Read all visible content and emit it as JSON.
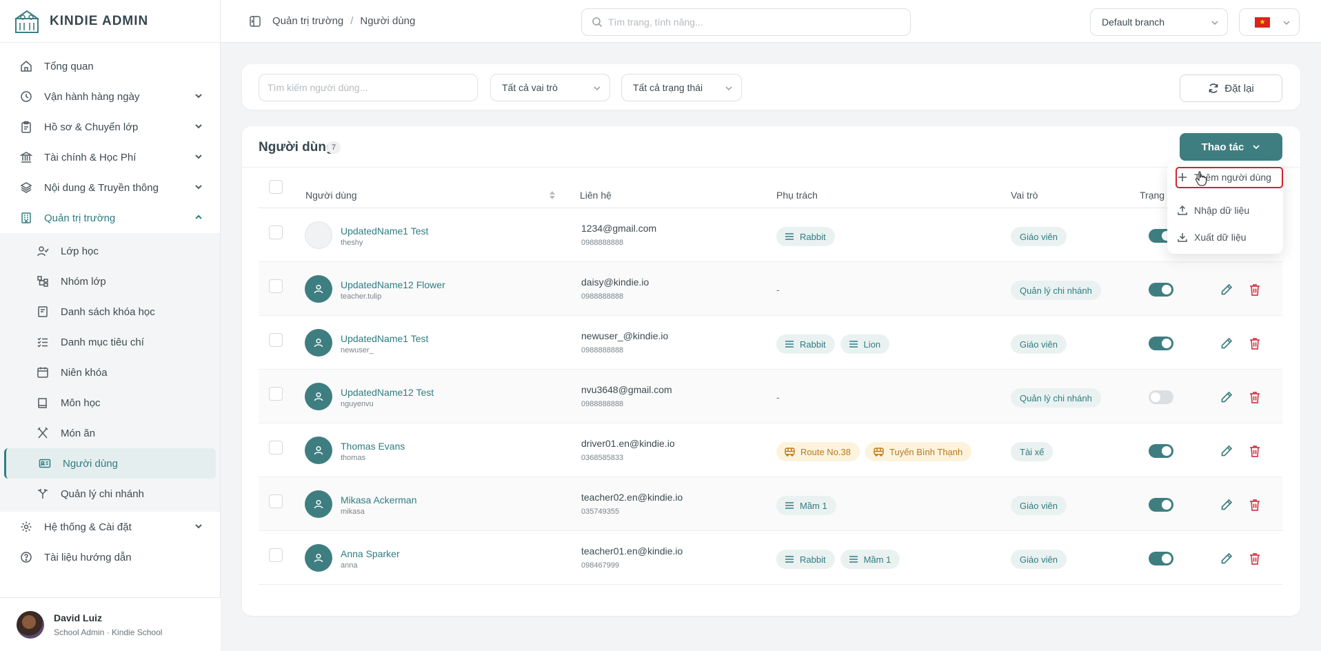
{
  "app": {
    "brand": "KINDIE ADMIN"
  },
  "sidebar": {
    "items": [
      {
        "label": "Tổng quan",
        "icon": "home-icon",
        "expandable": false
      },
      {
        "label": "Vận hành hàng ngày",
        "icon": "clock-icon",
        "expandable": true
      },
      {
        "label": "Hồ sơ & Chuyển lớp",
        "icon": "clipboard-icon",
        "expandable": true
      },
      {
        "label": "Tài chính & Học Phí",
        "icon": "bank-icon",
        "expandable": true
      },
      {
        "label": "Nội dung & Truyền thông",
        "icon": "layers-icon",
        "expandable": true
      },
      {
        "label": "Quản trị trường",
        "icon": "building-icon",
        "expandable": true,
        "open": true
      }
    ],
    "subitems": [
      {
        "label": "Lớp học",
        "icon": "user-check-icon"
      },
      {
        "label": "Nhóm lớp",
        "icon": "hierarchy-icon"
      },
      {
        "label": "Danh sách khóa học",
        "icon": "book-list-icon"
      },
      {
        "label": "Danh mục tiêu chí",
        "icon": "checklist-icon"
      },
      {
        "label": "Niên khóa",
        "icon": "calendar-icon"
      },
      {
        "label": "Môn học",
        "icon": "book-icon"
      },
      {
        "label": "Món ăn",
        "icon": "utensils-icon"
      },
      {
        "label": "Người dùng",
        "icon": "id-card-icon",
        "active": true
      },
      {
        "label": "Quản lý chi nhánh",
        "icon": "branch-icon"
      }
    ],
    "bottom_items": [
      {
        "label": "Hệ thống & Cài đặt",
        "icon": "gear-icon",
        "expandable": true
      },
      {
        "label": "Tài liệu hướng dẫn",
        "icon": "help-icon",
        "expandable": false
      }
    ],
    "profile": {
      "name": "David Luiz",
      "role": "School Admin · Kindie School"
    }
  },
  "topbar": {
    "breadcrumb": [
      "Quản trị trường",
      "/",
      "Người dùng"
    ],
    "search_placeholder": "Tìm trang, tính năng...",
    "branch": "Default branch",
    "language_flag": "vn-flag"
  },
  "filters": {
    "search_placeholder": "Tìm kiếm người dùng...",
    "role_select": "Tất cả vai trò",
    "status_select": "Tất cả trạng thái",
    "reset_label": "Đặt lại"
  },
  "users": {
    "title": "Người dùng",
    "count": "7",
    "actions_label": "Thao tác",
    "columns": [
      "Người dùng",
      "Liên hệ",
      "Phụ trách",
      "Vai trò",
      "Trạng t"
    ],
    "rows": [
      {
        "name": "UpdatedName1 Test",
        "username": "theshy",
        "email": "1234@gmail.com",
        "phone": "0988888888",
        "charges": [
          {
            "label": "Rabbit",
            "kind": "class"
          }
        ],
        "dash": "",
        "role": "Giáo viên",
        "active": true,
        "photo": true
      },
      {
        "name": "UpdatedName12 Flower",
        "username": "teacher.tulip",
        "email": "daisy@kindie.io",
        "phone": "0988888888",
        "charges": [],
        "dash": "-",
        "role": "Quản lý chi nhánh",
        "active": true,
        "photo": false
      },
      {
        "name": "UpdatedName1 Test",
        "username": "newuser_",
        "email": "newuser_@kindie.io",
        "phone": "0988888888",
        "charges": [
          {
            "label": "Rabbit",
            "kind": "class"
          },
          {
            "label": "Lion",
            "kind": "class"
          }
        ],
        "dash": "",
        "role": "Giáo viên",
        "active": true,
        "photo": false
      },
      {
        "name": "UpdatedName12 Test",
        "username": "nguyenvu",
        "email": "nvu3648@gmail.com",
        "phone": "0988888888",
        "charges": [],
        "dash": "-",
        "role": "Quản lý chi nhánh",
        "active": false,
        "photo": false
      },
      {
        "name": "Thomas Evans",
        "username": "thomas",
        "email": "driver01.en@kindie.io",
        "phone": "0368585833",
        "charges": [
          {
            "label": "Route No.38",
            "kind": "route"
          },
          {
            "label": "Tuyến Bình Thạnh",
            "kind": "route"
          }
        ],
        "dash": "",
        "role": "Tài xế",
        "active": true,
        "photo": false
      },
      {
        "name": "Mikasa Ackerman",
        "username": "mikasa",
        "email": "teacher02.en@kindie.io",
        "phone": "035749355",
        "charges": [
          {
            "label": "Mầm 1",
            "kind": "class"
          }
        ],
        "dash": "",
        "role": "Giáo viên",
        "active": true,
        "photo": false
      },
      {
        "name": "Anna Sparker",
        "username": "anna",
        "email": "teacher01.en@kindie.io",
        "phone": "098467999",
        "charges": [
          {
            "label": "Rabbit",
            "kind": "class"
          },
          {
            "label": "Mầm 1",
            "kind": "class"
          }
        ],
        "dash": "",
        "role": "Giáo viên",
        "active": true,
        "photo": false
      }
    ]
  },
  "dropdown": {
    "items": [
      {
        "label": "Thêm người dùng",
        "icon": "plus-icon"
      },
      {
        "label": "Nhập dữ liệu",
        "icon": "upload-icon"
      },
      {
        "label": "Xuất dữ liệu",
        "icon": "download-icon"
      }
    ]
  },
  "colors": {
    "accent": "#3e7e81",
    "danger": "#d23b4a",
    "route": "#b7791f"
  }
}
